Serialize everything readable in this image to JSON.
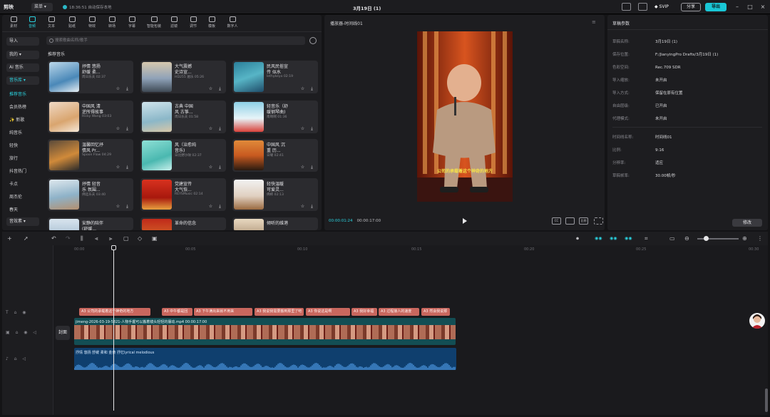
{
  "app": {
    "logo": "剪映",
    "menu_label": "菜单",
    "save_status": "18:36:51 自动保存本地",
    "doc_title": "3月19日 (1)"
  },
  "titlebar": {
    "svip_label": "SVIP",
    "share_label": "分享",
    "export_label": "导出"
  },
  "tool_tabs": [
    "素材",
    "音频",
    "文本",
    "贴纸",
    "特效",
    "转场",
    "字幕",
    "智能包装",
    "滤镜",
    "调节",
    "模板",
    "数字人"
  ],
  "sidebar": {
    "buttons": [
      "导入",
      "我的",
      "AI 音乐",
      "音乐库"
    ],
    "items": [
      "推荐音乐",
      "会员热榜",
      "✨ 新歌",
      "纯音乐",
      "轻快",
      "旅行",
      "抖音热门",
      "卡点",
      "周杰伦",
      "春天"
    ],
    "bottom_button": "音效素"
  },
  "search": {
    "placeholder": "搜索歌曲名称/歌手"
  },
  "section_title": "推荐音乐",
  "music_cards": [
    {
      "l1": "抒情 悠扬",
      "l2": "舒缓 柔...",
      "meta": "周日乐夫 02:37",
      "thumb": "linear-gradient(160deg,#bcd8ea,#4a88b8 60%,#e6edf2)"
    },
    {
      "l1": "大气震撼",
      "l2": "史诗宣...",
      "meta": "HD255 遍乐 05:26",
      "thumb": "linear-gradient(180deg,#d6c8ae,#8fa2b8 55%,#3f4a55)"
    },
    {
      "l1": "民风民俗宣",
      "l2": "传 似水",
      "meta": "lethykeyo 02:19",
      "thumb": "linear-gradient(160deg,#2b7f9a,#57b5c6 50%,#1f4d6a)"
    },
    {
      "l1": "中国风 清",
      "l2": "逆所得故事",
      "meta": "Ricky Wang 03:03",
      "thumb": "linear-gradient(160deg,#f0d9c6,#d9a56f 60%,#f5e8d8)"
    },
    {
      "l1": "古典 中国",
      "l2": "风 古筝...",
      "meta": "周日乐夫 01:58",
      "thumb": "linear-gradient(170deg,#cfe4ec,#8bb7c8 60%,#d8c7a8)"
    },
    {
      "l1": "轻音乐（舒",
      "l2": "缓钢琴曲)",
      "meta": "南啊啊 01:36",
      "thumb": "linear-gradient(180deg,#8fd0e6,#e7f4f8 55%,#d9423a)"
    },
    {
      "l1": "温馨回忆抒",
      "l2": "情风 Pr...",
      "meta": "Spoon Flow 04:29",
      "thumb": "linear-gradient(160deg,#5a4a3a,#d08a3a 55%,#2a2a2a)"
    },
    {
      "l1": "风（治愈纯",
      "l2": "音乐)",
      "meta": "日比野沙咲 02:37",
      "thumb": "linear-gradient(160deg,#8fe0d6,#4ab8b0 60%,#c8f0ec)"
    },
    {
      "l1": "中国风 沉",
      "l2": "重 历...",
      "meta": "日曜 02:41",
      "thumb": "linear-gradient(180deg,#e08a3a,#c85a20 50%,#2a1a10)"
    },
    {
      "l1": "抒情 轻音",
      "l2": "乐 氛围...",
      "meta": "佛廷乐夫 03:40",
      "thumb": "linear-gradient(170deg,#dfe8ee,#8eb2c8 55%,#b49070)"
    },
    {
      "l1": "党建宣传",
      "l2": "大气恢...",
      "meta": "REYSMusic 02:14",
      "thumb": "linear-gradient(180deg,#d8321f,#a8180d 60%,#e8a040)"
    },
    {
      "l1": "轻快温暖",
      "l2": "可爱灵...",
      "meta": "佛柿 02:13",
      "thumb": "linear-gradient(180deg,#f2f2f2,#e0d0c0 55%,#9a6a40)"
    },
    {
      "l1": "安静的陪伴",
      "l2": "(舒缓...",
      "meta": "",
      "thumb": "linear-gradient(180deg,#d8e4ee,#8aa8c0)"
    },
    {
      "l1": "革命的信念",
      "l2": "",
      "meta": "音乐人 02:26",
      "thumb": "linear-gradient(180deg,#c02a1a,#e08a30)"
    },
    {
      "l1": "倾听的维港",
      "l2": "",
      "meta": "",
      "thumb": "linear-gradient(180deg,#e8d8c0,#8a6a4a)"
    }
  ],
  "player": {
    "title": "播放器-时间线01",
    "current_time": "00:00:01:24",
    "total_time": "00:00:17:00",
    "subtitle_text": "公司的承载着这个神奇的地方",
    "ratio_btn": "比例",
    "cc_btn": "CC"
  },
  "props": {
    "title": "草稿参数",
    "rows1": [
      {
        "k": "草稿名称:",
        "v": "3月19日 (1)"
      },
      {
        "k": "保存位置:",
        "v": "F:/JianyingPro Drafts/3月19日 (1)"
      },
      {
        "k": "色彩空间:",
        "v": "Rec.709 SDR"
      },
      {
        "k": "导入缩放:",
        "v": "未开启"
      },
      {
        "k": "导入方式:",
        "v": "保留在原有位置"
      },
      {
        "k": "自由层级:",
        "v": "已开启"
      },
      {
        "k": "代理模式:",
        "v": "未开启"
      }
    ],
    "rows2": [
      {
        "k": "时间线名称:",
        "v": "时间线01"
      },
      {
        "k": "比例:",
        "v": "9:16"
      },
      {
        "k": "分辨率:",
        "v": "适应"
      },
      {
        "k": "草稿帧率:",
        "v": "30.00帧/秒"
      }
    ],
    "modify_label": "修改"
  },
  "timeline": {
    "ruler": [
      "00:00",
      "00:05",
      "00:10",
      "00:15",
      "00:20",
      "00:25",
      "00:30"
    ],
    "cover_label": "封面",
    "tts_clips": [
      "A3 公司的承载着这个神奇的地方",
      "A3 中午都是回",
      "A3 下午满出来就不用来",
      "A3 我说我需要搬到那里了吧",
      "A3 你说这是啊",
      "A3 我好幸福",
      "A3 过程接人的速度",
      "A3 然会我说那"
    ],
    "video_label": "jimeng-2026-03-19-5821-人物手握可以搬着镜头轻轻的摆动.mp4  00:00:17:00",
    "audio_label": "抒情 悠扬 舒缓 柔和 金黄 抒忆lyrical melodious"
  },
  "colors": {
    "accent": "#2bd3e0",
    "export": "#19c6d5",
    "tts": "#c9675e",
    "video_clip": "#134e54",
    "audio_clip": "#0f3f6e"
  }
}
